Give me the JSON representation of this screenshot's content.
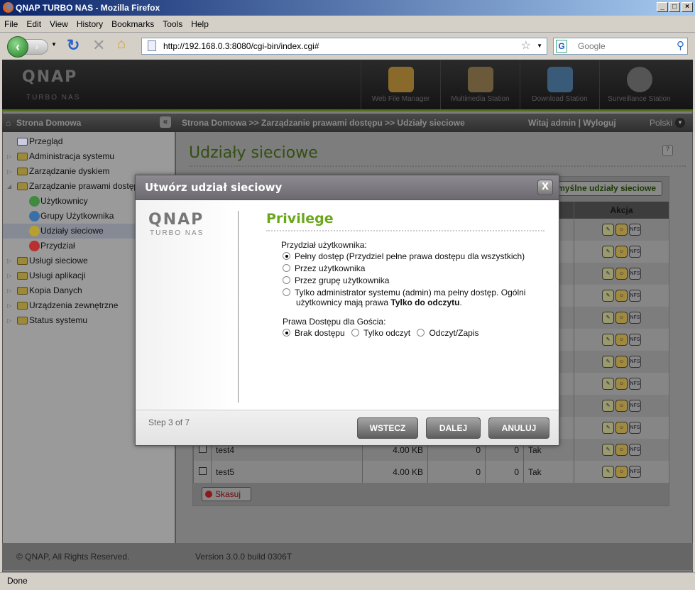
{
  "window": {
    "title": "QNAP TURBO NAS - Mozilla Firefox"
  },
  "menu": [
    "File",
    "Edit",
    "View",
    "History",
    "Bookmarks",
    "Tools",
    "Help"
  ],
  "browser": {
    "url": "http://192.168.0.3:8080/cgi-bin/index.cgi#",
    "search_placeholder": "Google",
    "status": "Done"
  },
  "header": {
    "logo": "QNAP",
    "logo_sub": "TURBO NAS",
    "stations": [
      "Web File Manager",
      "Multimedia Station",
      "Download Station",
      "Surveillance Station"
    ]
  },
  "crumbs": {
    "home": "Strona Domowa",
    "path": "Strona Domowa >> Zarządzanie prawami dostępu >> Udziały sieciowe",
    "welcome": "Witaj admin | Wyloguj",
    "language": "Polski"
  },
  "sidebar": {
    "items": [
      {
        "label": "Przegląd",
        "type": "leaf"
      },
      {
        "label": "Administracja systemu",
        "type": "folder"
      },
      {
        "label": "Zarządzanie dyskiem",
        "type": "folder"
      },
      {
        "label": "Zarządzanie prawami dostępu",
        "type": "open"
      },
      {
        "label": "Użytkownicy",
        "type": "sub",
        "color": "#3f8a3f"
      },
      {
        "label": "Grupy Użytkownika",
        "type": "sub",
        "color": "#3a6fa8"
      },
      {
        "label": "Udziały sieciowe",
        "type": "sub",
        "color": "#b8a030",
        "selected": true
      },
      {
        "label": "Przydział",
        "type": "sub",
        "color": "#b83030"
      },
      {
        "label": "Usługi sieciowe",
        "type": "folder"
      },
      {
        "label": "Usługi aplikacji",
        "type": "folder"
      },
      {
        "label": "Kopia Danych",
        "type": "folder"
      },
      {
        "label": "Urządzenia zewnętrzne",
        "type": "folder"
      },
      {
        "label": "Status systemu",
        "type": "folder"
      }
    ]
  },
  "main": {
    "title": "Udziały sieciowe",
    "default_shares_button": "Domyślne udziały sieciowe",
    "action_header": "Akcja",
    "delete_button": "Skasuj",
    "nfs_label": "NFS",
    "rows": [
      {
        "name": "",
        "size": "",
        "a": "",
        "b": "",
        "c": ""
      },
      {
        "name": "",
        "size": "",
        "a": "",
        "b": "",
        "c": ""
      },
      {
        "name": "",
        "size": "",
        "a": "",
        "b": "",
        "c": ""
      },
      {
        "name": "",
        "size": "",
        "a": "",
        "b": "",
        "c": ""
      },
      {
        "name": "",
        "size": "",
        "a": "",
        "b": "",
        "c": ""
      },
      {
        "name": "",
        "size": "",
        "a": "",
        "b": "",
        "c": ""
      },
      {
        "name": "",
        "size": "",
        "a": "",
        "b": "",
        "c": ""
      },
      {
        "name": "",
        "size": "",
        "a": "",
        "b": "",
        "c": ""
      },
      {
        "name": "",
        "size": "",
        "a": "",
        "b": "",
        "c": ""
      },
      {
        "name": "",
        "size": "",
        "a": "",
        "b": "",
        "c": ""
      },
      {
        "name": "test4",
        "size": "4.00 KB",
        "a": "0",
        "b": "0",
        "c": "Tak"
      },
      {
        "name": "test5",
        "size": "4.00 KB",
        "a": "0",
        "b": "0",
        "c": "Tak"
      }
    ]
  },
  "dialog": {
    "title": "Utwórz udział sieciowy",
    "close": "X",
    "section": "Privilege",
    "user_label": "Przydział użytkownika:",
    "user_options": [
      {
        "label": "Pełny dostęp (Przydziel pełne prawa dostępu dla wszystkich)",
        "checked": true
      },
      {
        "label": "Przez użytkownika",
        "checked": false
      },
      {
        "label": "Przez grupę użytkownika",
        "checked": false
      },
      {
        "label": "Tylko administrator systemu (admin) ma pełny dostęp. Ogólni",
        "label2": "użytkownicy mają prawa ",
        "bold": "Tylko do odczytu",
        "end": ".",
        "checked": false
      }
    ],
    "guest_label": "Prawa Dostępu dla Gościa:",
    "guest_options": [
      {
        "label": "Brak dostępu",
        "checked": true
      },
      {
        "label": "Tylko odczyt",
        "checked": false
      },
      {
        "label": "Odczyt/Zapis",
        "checked": false
      }
    ],
    "step": "Step 3 of 7",
    "back": "WSTECZ",
    "next": "DALEJ",
    "cancel": "ANULUJ"
  },
  "footer": {
    "copyright": "© QNAP, All Rights Reserved.",
    "version": "Version 3.0.0 build 0306T"
  },
  "colors": {
    "accent_green": "#6aa819",
    "header_bg": "#1c1c1c"
  }
}
